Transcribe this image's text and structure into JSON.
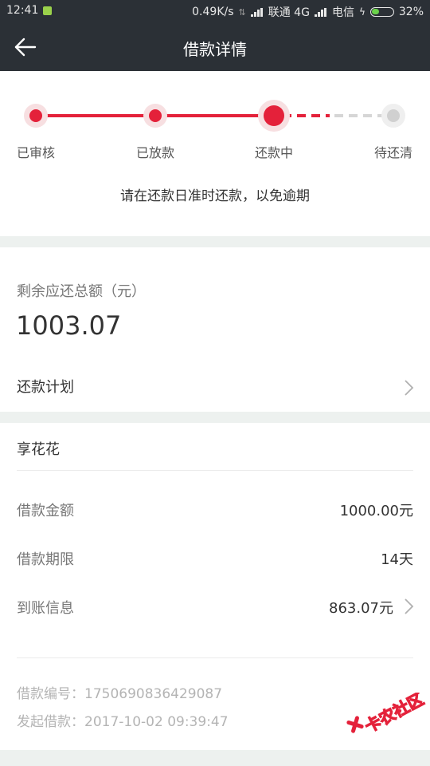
{
  "status_bar": {
    "time": "12:41",
    "net_speed": "0.49K/s",
    "carrier1": "联通 4G",
    "carrier2": "电信",
    "battery": "32%"
  },
  "header": {
    "title": "借款详情"
  },
  "progress": {
    "steps": [
      "已审核",
      "已放款",
      "还款中",
      "待还清"
    ],
    "current_index": 2,
    "notice": "请在还款日准时还款，以免逾期"
  },
  "balance": {
    "label": "剩余应还总额（元）",
    "amount": "1003.07",
    "plan_label": "还款计划"
  },
  "loan": {
    "product": "享花花",
    "rows": [
      {
        "label": "借款金额",
        "value": "1000.00元"
      },
      {
        "label": "借款期限",
        "value": "14天"
      },
      {
        "label": "到账信息",
        "value": "863.07元"
      }
    ],
    "loan_no": "借款编号：1750690836429087",
    "loan_time": "发起借款：2017-10-02 09:39:47"
  },
  "watermark": {
    "text": "卡农社区"
  },
  "colors": {
    "accent": "#e4213a",
    "header_bg": "#2b3036",
    "section_gap": "#edf1ef"
  }
}
